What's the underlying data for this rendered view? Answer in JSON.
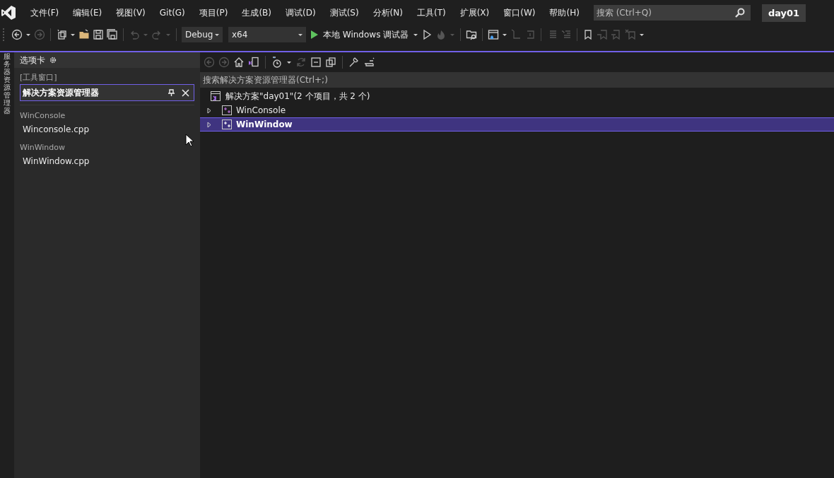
{
  "menu": [
    "文件(F)",
    "编辑(E)",
    "视图(V)",
    "Git(G)",
    "项目(P)",
    "生成(B)",
    "调试(D)",
    "测试(S)",
    "分析(N)",
    "工具(T)",
    "扩展(X)",
    "窗口(W)",
    "帮助(H)"
  ],
  "search": {
    "placeholder": "搜索 (Ctrl+Q)"
  },
  "solution_badge": "day01",
  "toolbar": [
    {
      "kind": "icon",
      "disabled": false
    },
    {
      "kind": "caret",
      "disabled": false
    },
    {
      "kind": "icon",
      "disabled": true
    },
    {
      "kind": "sep"
    },
    {
      "kind": "icon",
      "disabled": false
    },
    {
      "kind": "caret",
      "disabled": false
    },
    {
      "kind": "icon",
      "disabled": false
    },
    {
      "kind": "icon",
      "disabled": false
    },
    {
      "kind": "icon",
      "disabled": false
    },
    {
      "kind": "sep"
    },
    {
      "kind": "icon",
      "disabled": true
    },
    {
      "kind": "caret",
      "disabled": true
    },
    {
      "kind": "icon",
      "disabled": true
    },
    {
      "kind": "caret",
      "disabled": true
    },
    {
      "kind": "sep"
    },
    {
      "kind": "dropdown",
      "value": "Debug",
      "wide": false
    },
    {
      "kind": "dropdown",
      "value": "x64",
      "wide": true
    },
    {
      "kind": "run",
      "label": "本地 Windows 调试器"
    },
    {
      "kind": "caret",
      "disabled": false
    },
    {
      "kind": "icon",
      "disabled": false
    },
    {
      "kind": "icon",
      "disabled": true
    },
    {
      "kind": "caret",
      "disabled": true
    },
    {
      "kind": "sep"
    },
    {
      "kind": "icon",
      "disabled": false
    },
    {
      "kind": "sep"
    },
    {
      "kind": "icon",
      "disabled": false
    },
    {
      "kind": "caret",
      "disabled": false
    },
    {
      "kind": "icon",
      "disabled": true
    },
    {
      "kind": "icon",
      "disabled": true
    },
    {
      "kind": "sep"
    },
    {
      "kind": "icon",
      "disabled": true
    },
    {
      "kind": "icon",
      "disabled": true
    },
    {
      "kind": "sep"
    },
    {
      "kind": "icon",
      "disabled": false
    },
    {
      "kind": "icon",
      "disabled": true
    },
    {
      "kind": "icon",
      "disabled": true
    },
    {
      "kind": "icon",
      "disabled": true
    },
    {
      "kind": "caret",
      "disabled": false
    }
  ],
  "side_tab": "服务器资源管理器",
  "tabs_panel": {
    "title": "选项卡",
    "group_label": "[工具窗口]",
    "active_window": "解决方案资源管理器",
    "groups": [
      {
        "label": "WinConsole",
        "files": [
          "Winconsole.cpp"
        ]
      },
      {
        "label": "WinWindow",
        "files": [
          "WinWindow.cpp"
        ]
      }
    ]
  },
  "solution_explorer": {
    "toolbar": [
      {
        "kind": "icon",
        "disabled": true
      },
      {
        "kind": "icon",
        "disabled": true
      },
      {
        "kind": "icon",
        "disabled": false
      },
      {
        "kind": "icon",
        "disabled": false
      },
      {
        "kind": "sep"
      },
      {
        "kind": "icon",
        "disabled": false
      },
      {
        "kind": "caret",
        "disabled": false
      },
      {
        "kind": "icon",
        "disabled": true
      },
      {
        "kind": "icon",
        "disabled": false
      },
      {
        "kind": "icon",
        "disabled": false
      },
      {
        "kind": "sep"
      },
      {
        "kind": "icon",
        "disabled": false
      },
      {
        "kind": "icon",
        "disabled": false
      }
    ],
    "search": {
      "placeholder": "搜索解决方案资源管理器(Ctrl+;)"
    },
    "root": "解决方案\"day01\"(2 个项目，共 2 个)",
    "projects": [
      {
        "name": "WinConsole",
        "selected": false,
        "expanded": false
      },
      {
        "name": "WinWindow",
        "selected": true,
        "expanded": false
      }
    ]
  }
}
